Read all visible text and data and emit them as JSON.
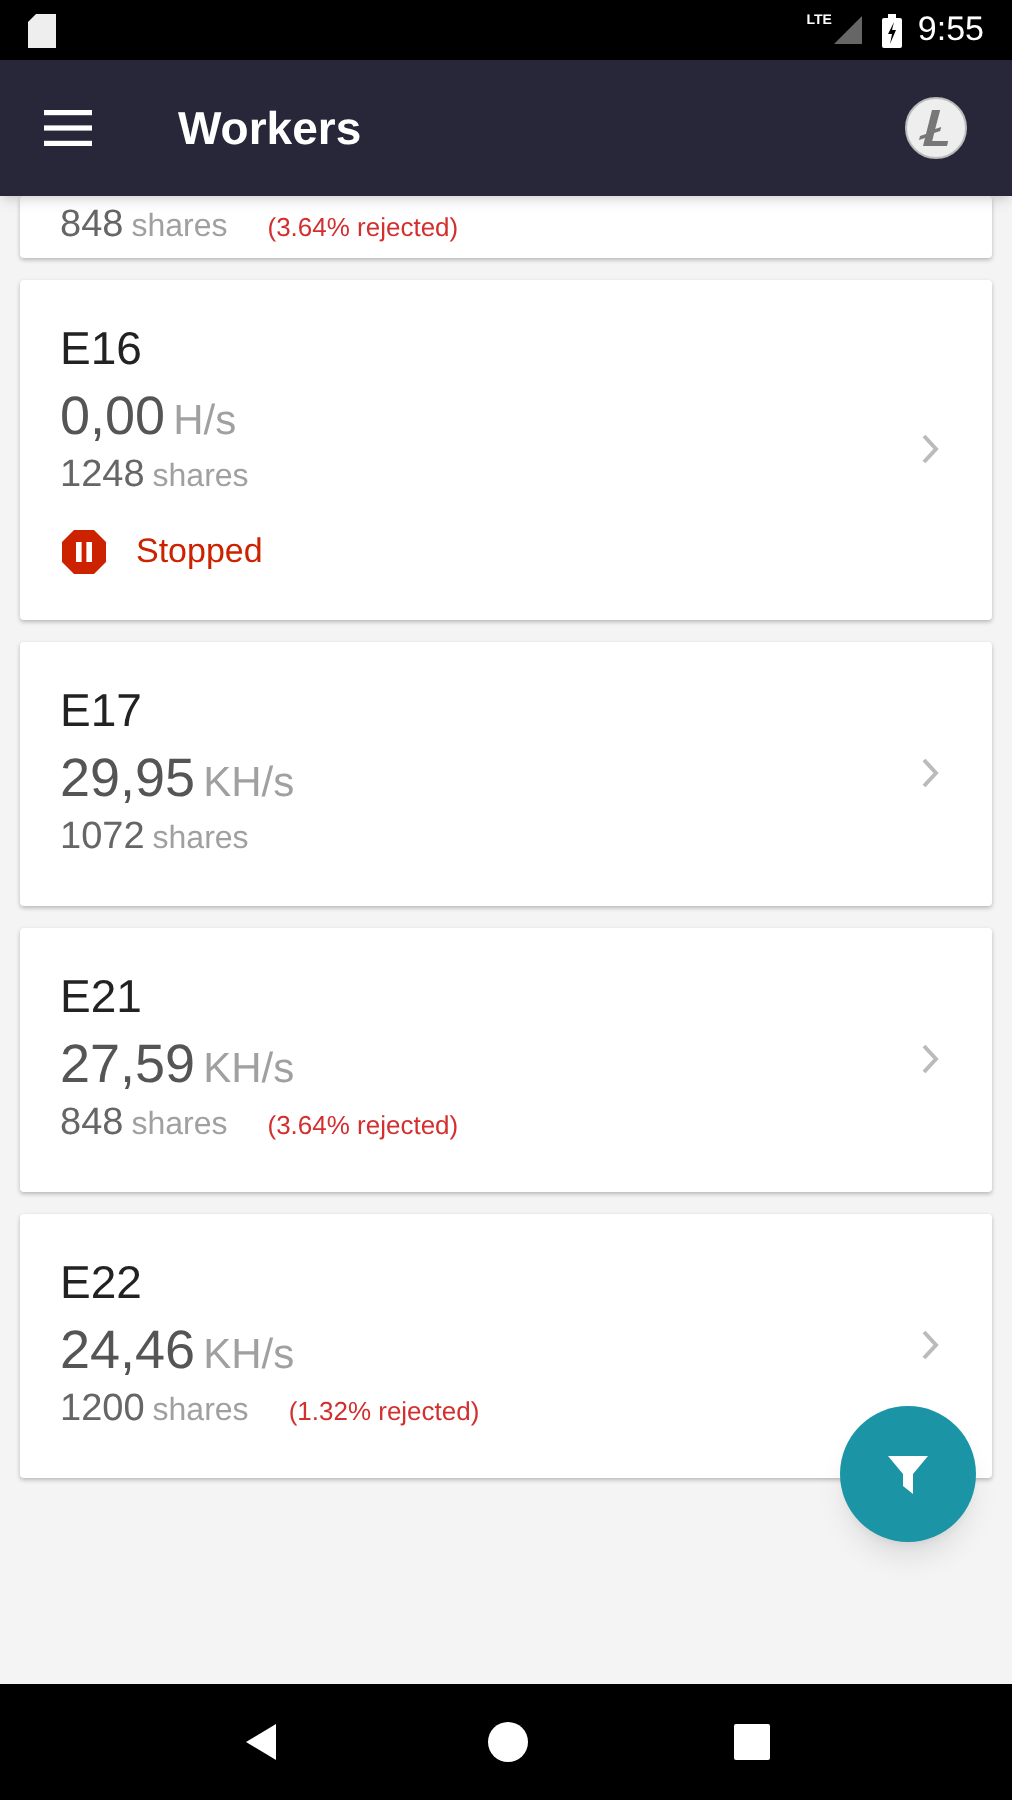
{
  "status_bar": {
    "network": "LTE",
    "time": "9:55"
  },
  "app_bar": {
    "title": "Workers"
  },
  "partial_card": {
    "shares": "848",
    "shares_label": "shares",
    "rejected": "(3.64% rejected)"
  },
  "workers": [
    {
      "name": "E16",
      "hashrate": "0,00",
      "unit": "H/s",
      "shares": "1248",
      "shares_label": "shares",
      "status": {
        "kind": "stopped",
        "label": "Stopped"
      }
    },
    {
      "name": "E17",
      "hashrate": "29,95",
      "unit": "KH/s",
      "shares": "1072",
      "shares_label": "shares"
    },
    {
      "name": "E21",
      "hashrate": "27,59",
      "unit": "KH/s",
      "shares": "848",
      "shares_label": "shares",
      "rejected": "(3.64% rejected)"
    },
    {
      "name": "E22",
      "hashrate": "24,46",
      "unit": "KH/s",
      "shares": "1200",
      "shares_label": "shares",
      "rejected": "(1.32% rejected)"
    }
  ]
}
